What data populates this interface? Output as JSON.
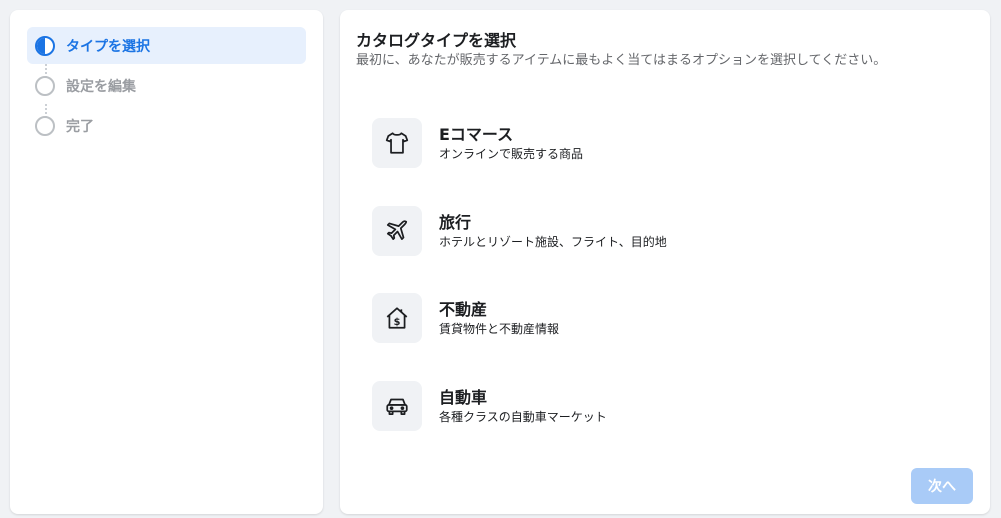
{
  "steps": [
    {
      "label": "タイプを選択",
      "state": "active"
    },
    {
      "label": "設定を編集",
      "state": "pending"
    },
    {
      "label": "完了",
      "state": "pending"
    }
  ],
  "main": {
    "title": "カタログタイプを選択",
    "subtitle": "最初に、あなたが販売するアイテムに最もよく当てはまるオプションを選択してください。",
    "options": [
      {
        "icon": "tshirt-icon",
        "title": "Eコマース",
        "description": "オンラインで販売する商品"
      },
      {
        "icon": "airplane-icon",
        "title": "旅行",
        "description": "ホテルとリゾート施設、フライト、目的地"
      },
      {
        "icon": "house-dollar-icon",
        "title": "不動産",
        "description": "賃貸物件と不動産情報"
      },
      {
        "icon": "car-icon",
        "title": "自動車",
        "description": "各種クラスの自動車マーケット"
      }
    ],
    "next_label": "次へ"
  },
  "colors": {
    "accent": "#1b74e4",
    "active_step_bg": "#e7f0fd",
    "disabled_button": "#a9cbf7",
    "page_bg": "#f0f2f5"
  }
}
